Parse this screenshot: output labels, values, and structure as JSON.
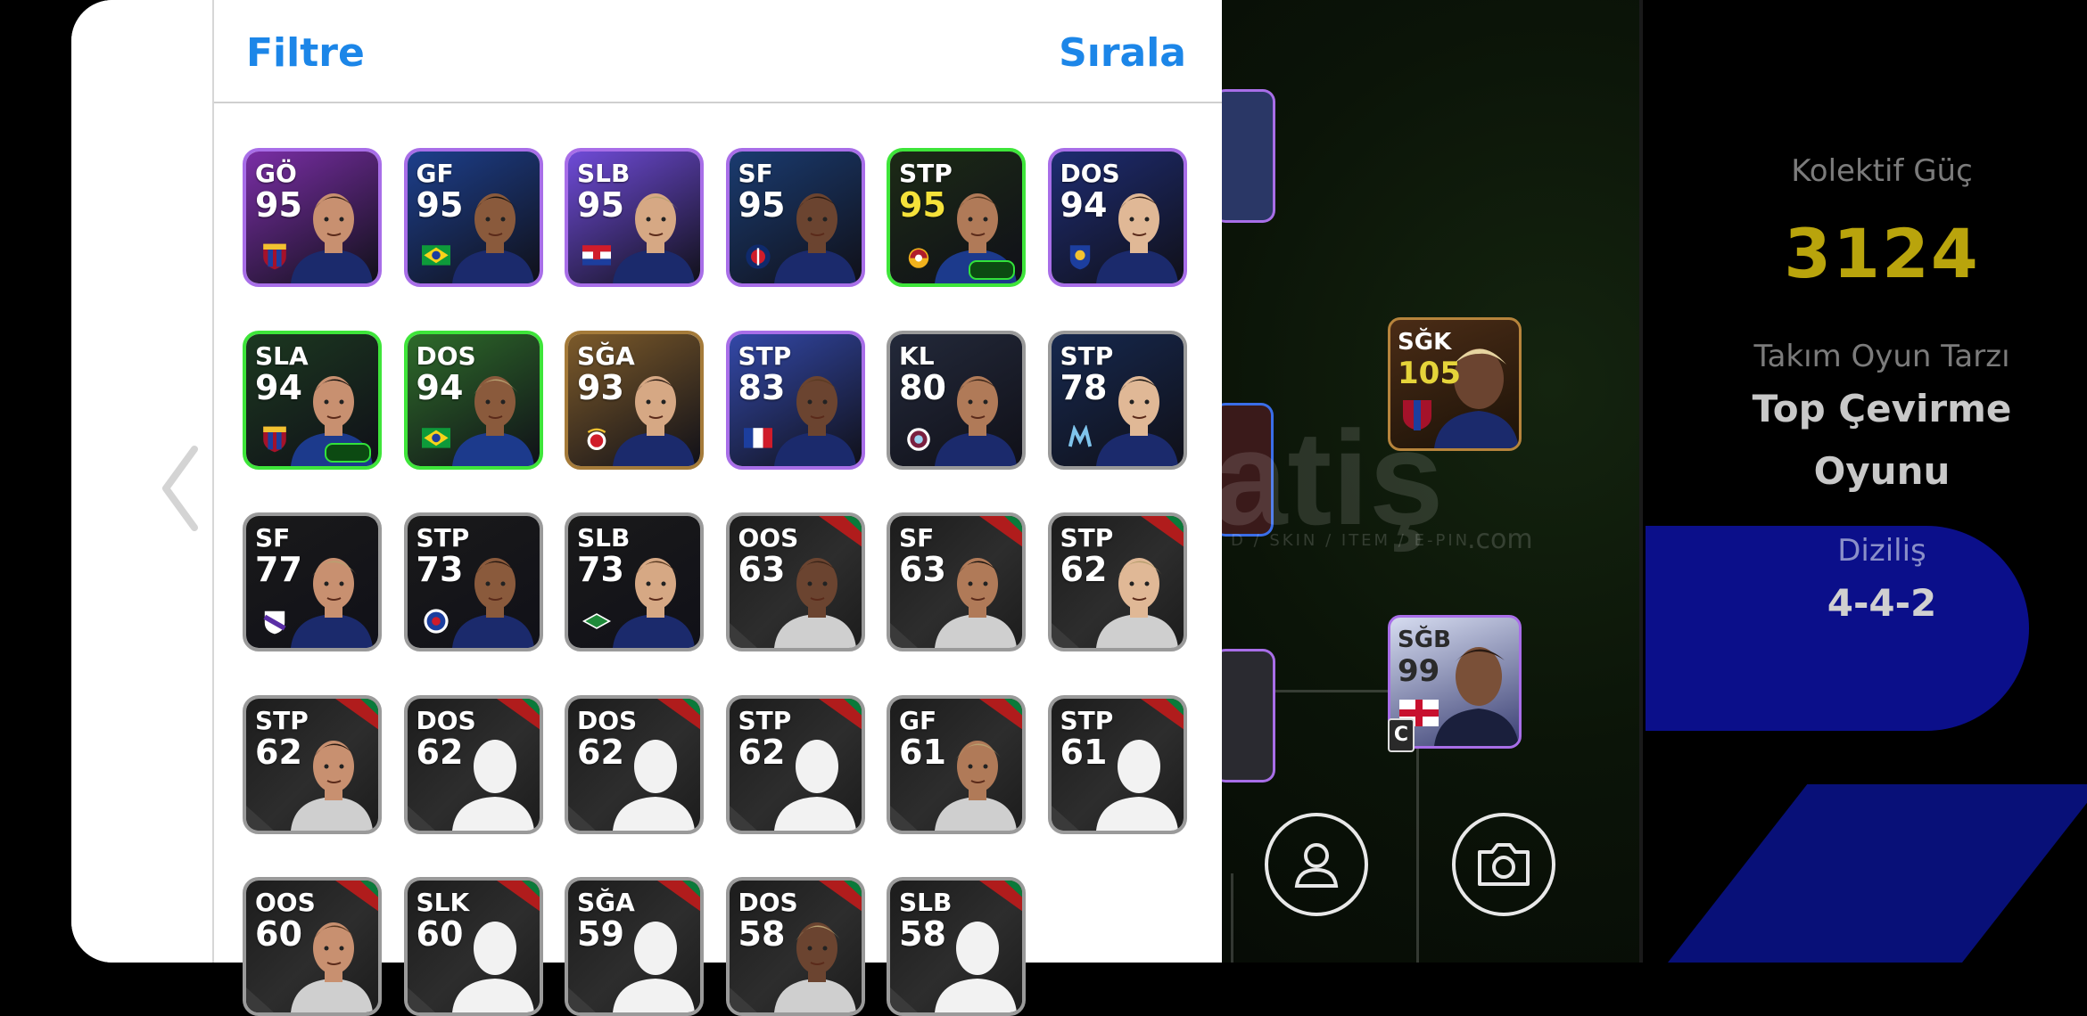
{
  "header": {
    "filter_label": "Filtre",
    "sort_label": "Sırala"
  },
  "team_stats": {
    "collective_power_label": "Kolektif Güç",
    "collective_power_value": "3124",
    "play_style_label": "Takım Oyun Tarzı",
    "play_style_line1": "Top Çevirme",
    "play_style_line2": "Oyunu",
    "formation_label": "Diziliş",
    "formation_value": "4-4-2"
  },
  "watermark": {
    "brand": "atiş",
    "sub": "D / SKIN / ITEM / E-PIN",
    "dotcom": ".com"
  },
  "pitch_players": [
    {
      "pos": "SĞK",
      "rating": "105",
      "rating_color": "#e5d43a"
    },
    {
      "pos": "SĞB",
      "rating": "99",
      "rating_color": "#ffffff"
    }
  ],
  "captain_badge": "C",
  "players": [
    {
      "pos": "GÖ",
      "rating": "95",
      "frame": "#a86ee8",
      "bg": "#7a2ea6",
      "badge": "barca"
    },
    {
      "pos": "GF",
      "rating": "95",
      "frame": "#a86ee8",
      "bg": "#1d3f8c",
      "badge": "brazil"
    },
    {
      "pos": "SLB",
      "rating": "95",
      "frame": "#a86ee8",
      "bg": "#6f4bd8",
      "badge": "croatia"
    },
    {
      "pos": "SF",
      "rating": "95",
      "frame": "#a86ee8",
      "bg": "#1a3b70",
      "badge": "psg"
    },
    {
      "pos": "STP",
      "rating": "95",
      "frame": "#3ee53a",
      "bg": "#1c2a16",
      "badge": "galatasaray",
      "gold": true,
      "chip": true
    },
    {
      "pos": "DOS",
      "rating": "94",
      "frame": "#a86ee8",
      "bg": "#1e2c72",
      "badge": "club"
    },
    {
      "pos": "SLA",
      "rating": "94",
      "frame": "#3ee53a",
      "bg": "#1c3820",
      "badge": "barca",
      "chip": true
    },
    {
      "pos": "DOS",
      "rating": "94",
      "frame": "#3ee53a",
      "bg": "#2e6b2a",
      "badge": "brazil"
    },
    {
      "pos": "SĞA",
      "rating": "93",
      "frame": "#a57b3a",
      "bg": "#7c5a2a",
      "badge": "benfica"
    },
    {
      "pos": "STP",
      "rating": "83",
      "frame": "#a86ee8",
      "bg": "#3348a8",
      "badge": "france"
    },
    {
      "pos": "KL",
      "rating": "80",
      "frame": "#9a9a9a",
      "bg": "#23293a",
      "badge": "aston"
    },
    {
      "pos": "STP",
      "rating": "78",
      "frame": "#9a9a9a",
      "bg": "#16284e",
      "badge": "om"
    },
    {
      "pos": "SF",
      "rating": "77",
      "frame": "#9a9a9a",
      "bg": "#1a1a1a",
      "badge": "club2"
    },
    {
      "pos": "STP",
      "rating": "73",
      "frame": "#9a9a9a",
      "bg": "#1a1a1a",
      "badge": "rangers"
    },
    {
      "pos": "SLB",
      "rating": "73",
      "frame": "#9a9a9a",
      "bg": "#1a1a1a",
      "badge": "green"
    },
    {
      "pos": "OOS",
      "rating": "63",
      "frame": "#9a9a9a",
      "bg": "#262626",
      "badge": ""
    },
    {
      "pos": "SF",
      "rating": "63",
      "frame": "#9a9a9a",
      "bg": "#262626",
      "badge": ""
    },
    {
      "pos": "STP",
      "rating": "62",
      "frame": "#9a9a9a",
      "bg": "#262626",
      "badge": ""
    },
    {
      "pos": "STP",
      "rating": "62",
      "frame": "#9a9a9a",
      "bg": "#262626",
      "badge": ""
    },
    {
      "pos": "DOS",
      "rating": "62",
      "frame": "#9a9a9a",
      "bg": "#262626",
      "badge": "",
      "blank": true
    },
    {
      "pos": "DOS",
      "rating": "62",
      "frame": "#9a9a9a",
      "bg": "#262626",
      "badge": "",
      "blank": true
    },
    {
      "pos": "STP",
      "rating": "62",
      "frame": "#9a9a9a",
      "bg": "#262626",
      "badge": "",
      "blank": true
    },
    {
      "pos": "GF",
      "rating": "61",
      "frame": "#9a9a9a",
      "bg": "#262626",
      "badge": ""
    },
    {
      "pos": "STP",
      "rating": "61",
      "frame": "#9a9a9a",
      "bg": "#262626",
      "badge": "",
      "blank": true
    },
    {
      "pos": "OOS",
      "rating": "60",
      "frame": "#9a9a9a",
      "bg": "#262626",
      "badge": ""
    },
    {
      "pos": "SLK",
      "rating": "60",
      "frame": "#9a9a9a",
      "bg": "#262626",
      "badge": "",
      "blank": true
    },
    {
      "pos": "SĞA",
      "rating": "59",
      "frame": "#9a9a9a",
      "bg": "#262626",
      "badge": "",
      "blank": true
    },
    {
      "pos": "DOS",
      "rating": "58",
      "frame": "#9a9a9a",
      "bg": "#262626",
      "badge": ""
    },
    {
      "pos": "SLB",
      "rating": "58",
      "frame": "#9a9a9a",
      "bg": "#262626",
      "badge": "",
      "blank": true
    }
  ]
}
